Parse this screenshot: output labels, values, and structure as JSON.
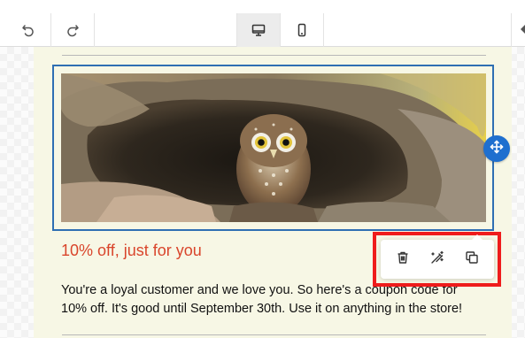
{
  "toolbar": {
    "undo_icon": "undo-icon",
    "redo_icon": "redo-icon",
    "desktop_icon": "desktop-icon",
    "mobile_icon": "mobile-icon",
    "active_device": "desktop"
  },
  "email": {
    "background_color": "#f7f7e5",
    "headline": "10% off, just for you",
    "headline_color": "#d9452b",
    "body": "You're a loyal customer and we love you. So here's a coupon code for 10% off. It's good until September 30th. Use it on anything in the store!"
  },
  "selection": {
    "border_color": "#2f6fb3",
    "move_icon": "move-icon"
  },
  "block_actions": {
    "delete_icon": "trash-icon",
    "edit_icon": "magic-wand-icon",
    "duplicate_icon": "duplicate-icon",
    "highlight_color": "#ef1c1c"
  }
}
